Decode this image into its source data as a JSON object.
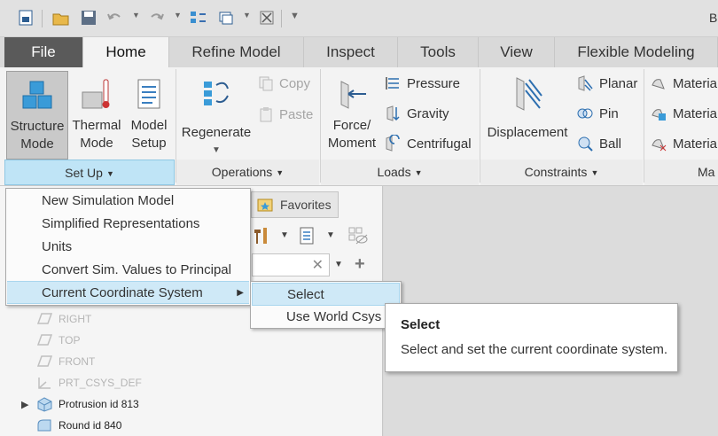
{
  "quick_access": {
    "items": [
      "new-icon",
      "open-icon",
      "save-icon",
      "undo-icon",
      "redo-icon",
      "regenerate-icon",
      "windows-icon",
      "close-icon",
      "customize-icon"
    ]
  },
  "app_title": "B",
  "tabs": [
    {
      "label": "File"
    },
    {
      "label": "Home"
    },
    {
      "label": "Refine Model"
    },
    {
      "label": "Inspect"
    },
    {
      "label": "Tools"
    },
    {
      "label": "View"
    },
    {
      "label": "Flexible Modeling"
    }
  ],
  "ribbon": {
    "setup": {
      "structure_label1": "Structure",
      "structure_label2": "Mode",
      "thermal_label1": "Thermal",
      "thermal_label2": "Mode",
      "model_label1": "Model",
      "model_label2": "Setup",
      "footer": "Set Up"
    },
    "operations": {
      "regenerate": "Regenerate",
      "copy": "Copy",
      "paste": "Paste",
      "footer": "Operations"
    },
    "loads": {
      "force1": "Force/",
      "force2": "Moment",
      "pressure": "Pressure",
      "gravity": "Gravity",
      "centrifugal": "Centrifugal",
      "footer": "Loads"
    },
    "constraints": {
      "displacement": "Displacement",
      "planar": "Planar",
      "pin": "Pin",
      "ball": "Ball",
      "footer": "Constraints"
    },
    "materials": {
      "item1": "Materia",
      "item2": "Materia",
      "item3": "Materia",
      "footer": "Ma"
    }
  },
  "panel": {
    "favorites_tab": "Favorites",
    "tree": [
      "RIGHT",
      "TOP",
      "FRONT",
      "PRT_CSYS_DEF",
      "Protrusion id 813",
      "Round id 840"
    ]
  },
  "menu": {
    "items": [
      "New Simulation Model",
      "Simplified Representations",
      "Units",
      "Convert Sim. Values to Principal",
      "Current Coordinate System"
    ]
  },
  "submenu": {
    "items": [
      "Select",
      "Use World Csys"
    ]
  },
  "tooltip": {
    "title": "Select",
    "body": "Select and set the current coordinate system."
  },
  "colors": {
    "accent": "#cfe9f7",
    "file_tab": "#5a5a5a",
    "ribbon_bg": "#f3f3f3",
    "structure_blue": "#3a9bd8"
  }
}
